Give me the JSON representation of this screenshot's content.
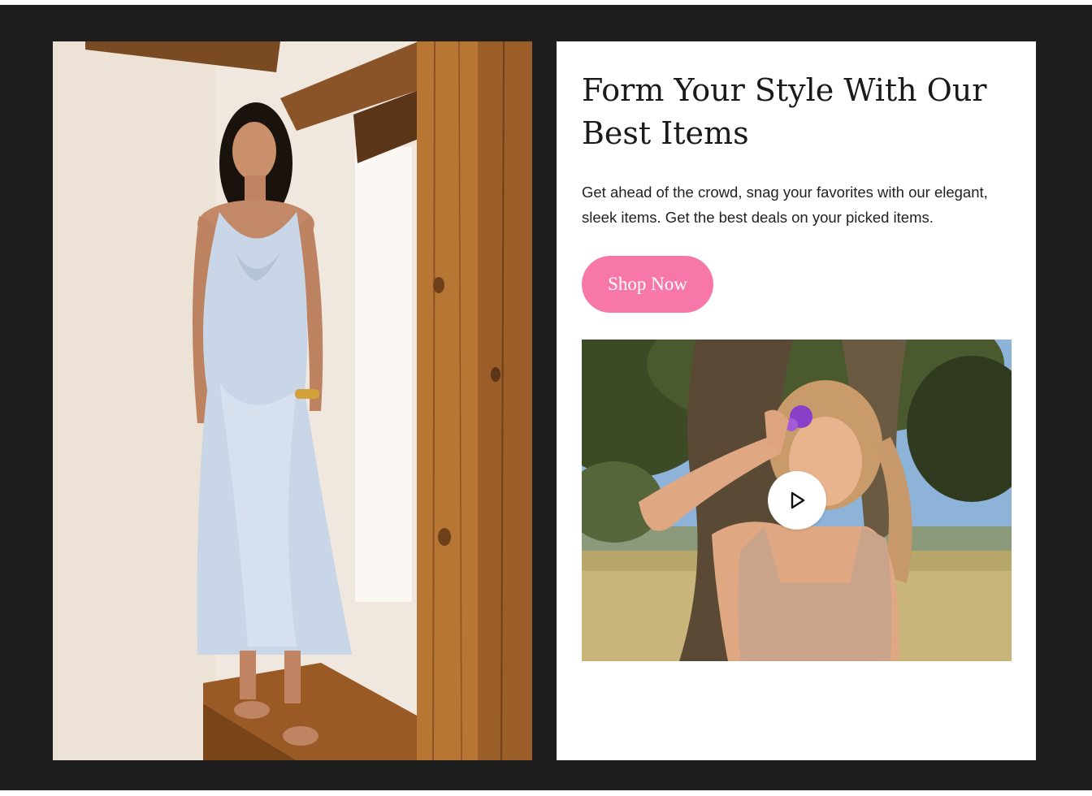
{
  "hero": {
    "headline": "Form Your Style With Our Best Items",
    "description": "Get ahead of the crowd, snag your favorites with our elegant, sleek items. Get the best deals on your picked items.",
    "cta_label": "Shop Now"
  },
  "video": {
    "play_icon": "play-icon"
  },
  "colors": {
    "frame_background": "#1e1e1e",
    "panel_background": "#ffffff",
    "cta_background": "#f778a8",
    "cta_text": "#ffffff",
    "heading_text": "#1a1a1a"
  }
}
